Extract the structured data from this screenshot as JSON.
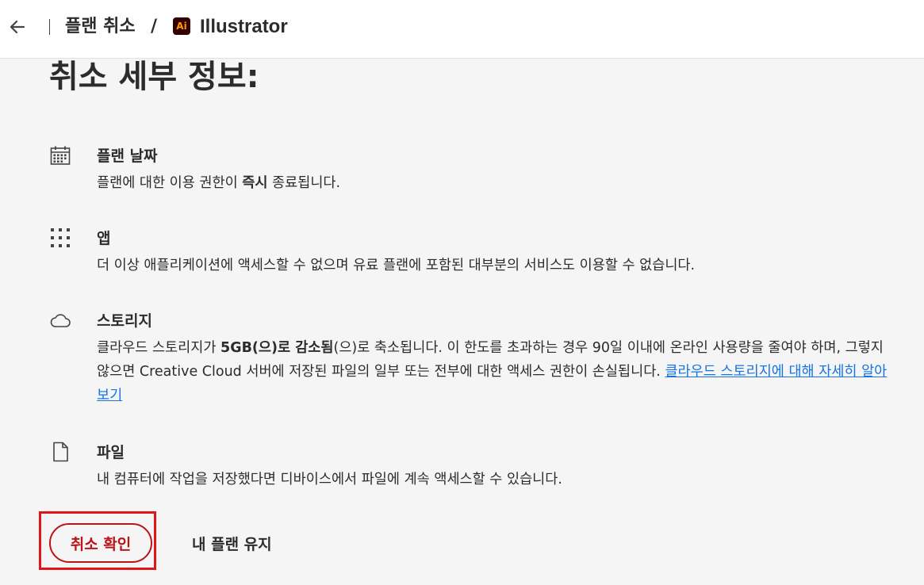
{
  "header": {
    "back_icon": "arrow-left-icon",
    "breadcrumb_plan": "플랜 취소",
    "breadcrumb_separator": "/",
    "app_logo_text": "Ai",
    "app_name": "Illustrator",
    "app_logo_colors": {
      "background": "#330000",
      "text": "#ff9a00"
    }
  },
  "main": {
    "title": "취소 세부 정보:",
    "sections": [
      {
        "icon": "calendar-icon",
        "title": "플랜 날짜",
        "body_before": "플랜에 대한 이용 권한이 ",
        "body_bold": "즉시",
        "body_after": " 종료됩니다."
      },
      {
        "icon": "app-grid-icon",
        "title": "앱",
        "body": "더 이상 애플리케이션에 액세스할 수 없으며 유료 플랜에 포함된 대부분의 서비스도 이용할 수 없습니다."
      },
      {
        "icon": "cloud-icon",
        "title": "스토리지",
        "body_before": "클라우드 스토리지가 ",
        "body_bold": "5GB(으)로 감소됨",
        "body_after": "(으)로 축소됩니다. 이 한도를 초과하는 경우 90일 이내에 온라인 사용량을 줄여야 하며, 그렇지 않으면 Creative Cloud 서버에 저장된 파일의 일부 또는 전부에 대한 액세스 권한이 손실됩니다. ",
        "link_text": "클라우드 스토리지에 대해 자세히 알아보기"
      },
      {
        "icon": "file-icon",
        "title": "파일",
        "body": "내 컴퓨터에 작업을 저장했다면 디바이스에서 파일에 계속 액세스할 수 있습니다."
      }
    ]
  },
  "actions": {
    "confirm_label": "취소 확인",
    "keep_label": "내 플랜 유지",
    "confirm_color": "#b9141a",
    "highlight_color": "#e0161b",
    "link_color": "#1473e6"
  }
}
